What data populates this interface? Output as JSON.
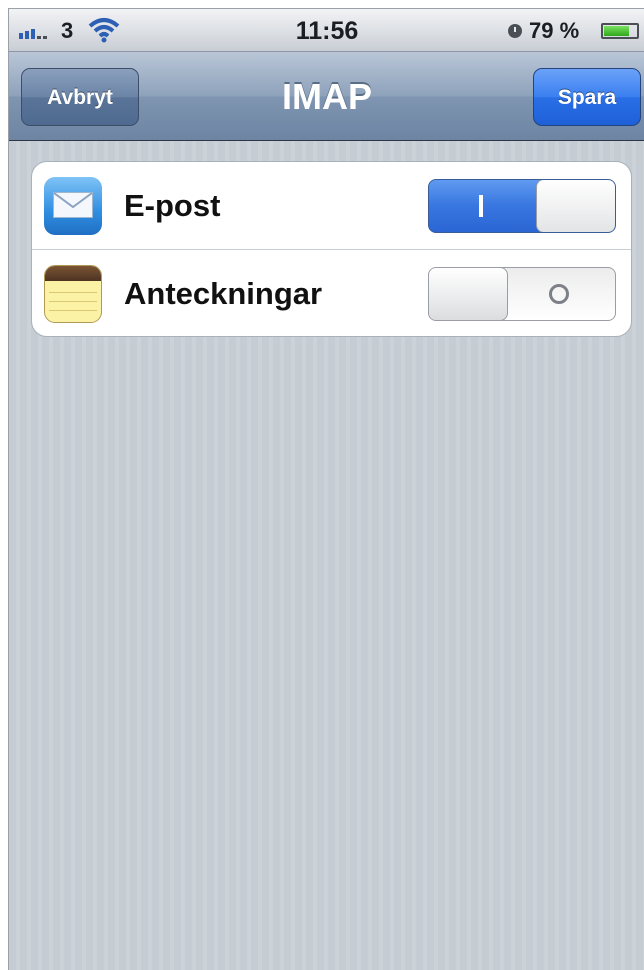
{
  "status_bar": {
    "carrier": "3",
    "time": "11:56",
    "battery_percent_text": "79 %",
    "battery_level": 0.79,
    "icons": [
      "signal-bars-icon",
      "wifi-icon",
      "alarm-icon",
      "battery-icon"
    ]
  },
  "nav": {
    "title": "IMAP",
    "cancel_label": "Avbryt",
    "save_label": "Spara"
  },
  "settings": [
    {
      "label": "E-post",
      "icon": "mail-icon",
      "enabled": true
    },
    {
      "label": "Anteckningar",
      "icon": "notes-icon",
      "enabled": false
    }
  ],
  "colors": {
    "switch_on": "#3876e0",
    "save_button": "#2a6fe6",
    "navbar": "#8ea2bb"
  }
}
